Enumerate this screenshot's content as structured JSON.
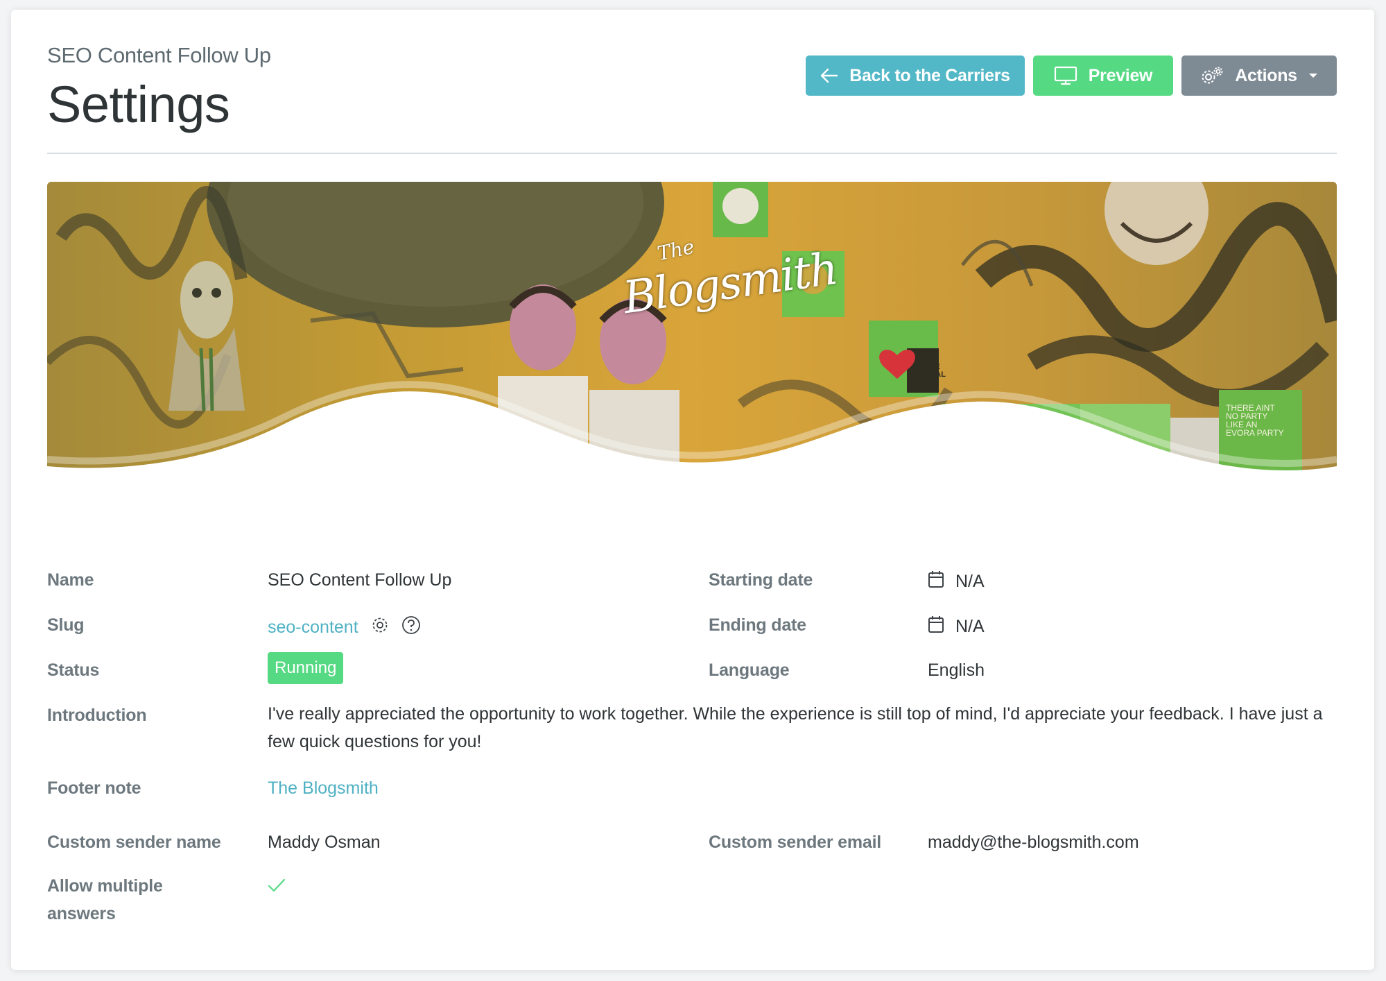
{
  "header": {
    "subtitle": "SEO Content Follow Up",
    "title": "Settings",
    "buttons": {
      "back_label": "Back to the Carriers",
      "preview_label": "Preview",
      "actions_label": "Actions"
    }
  },
  "banner": {
    "logo_small": "The",
    "logo_main": "Blogsmith",
    "sticker_the_real": "THE REAL",
    "sticker_party": "THERE AINT NO PARTY LIKE AN EVORA PARTY"
  },
  "fields": {
    "name": {
      "label": "Name",
      "value": "SEO Content Follow Up"
    },
    "starting_date": {
      "label": "Starting date",
      "value": "N/A"
    },
    "slug": {
      "label": "Slug",
      "value": "seo-content"
    },
    "ending_date": {
      "label": "Ending date",
      "value": "N/A"
    },
    "status": {
      "label": "Status",
      "value": "Running"
    },
    "language": {
      "label": "Language",
      "value": "English"
    },
    "introduction": {
      "label": "Introduction",
      "value": "I've really appreciated the opportunity to work together. While the experience is still top of mind, I'd appreciate your feedback. I have just a few quick questions for you!"
    },
    "footer_note": {
      "label": "Footer note",
      "value": "The Blogsmith"
    },
    "custom_sender_name": {
      "label": "Custom sender name",
      "value": "Maddy Osman"
    },
    "custom_sender_email": {
      "label": "Custom sender email",
      "value": "maddy@the-blogsmith.com"
    },
    "allow_multiple_answers": {
      "label_line1": "Allow multiple",
      "label_line2": "answers",
      "value": true
    }
  },
  "colors": {
    "accent_teal": "#52b7c6",
    "success_green": "#55d982",
    "neutral_gray": "#7e8b94",
    "label_gray": "#6d787e"
  },
  "icons": [
    "arrow-left-icon",
    "monitor-icon",
    "gears-icon",
    "caret-down-icon",
    "gear-icon",
    "help-circle-icon",
    "calendar-icon",
    "check-icon"
  ]
}
